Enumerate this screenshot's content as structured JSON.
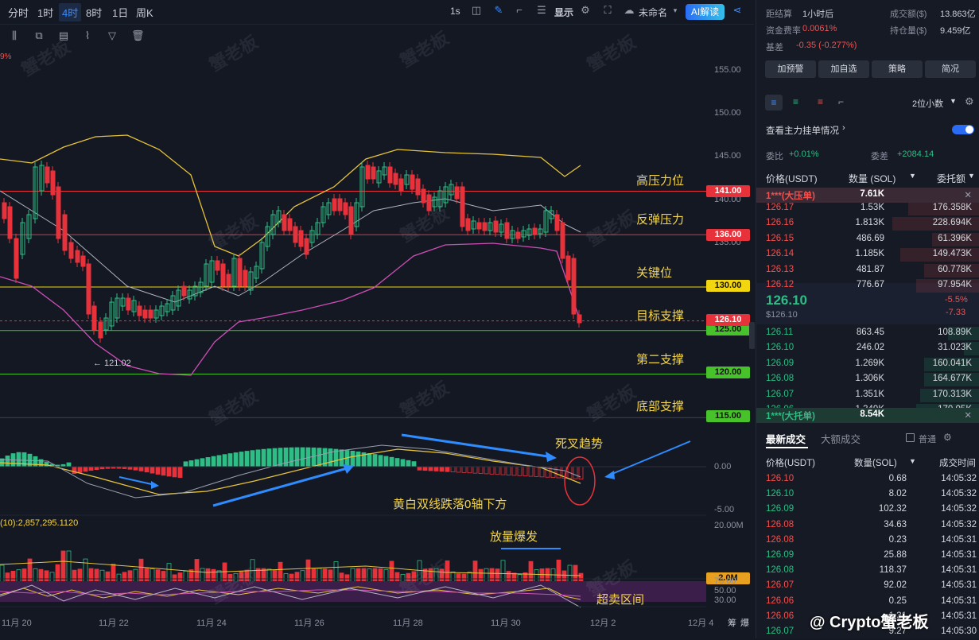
{
  "toolbar": {
    "timeframes": [
      "分时",
      "1时",
      "4时",
      "8时",
      "1日",
      "周K"
    ],
    "active_timeframe": "4时",
    "interval": "1s",
    "display_label": "显示",
    "layout_name": "未命名",
    "ai_label": "AI解读"
  },
  "chart": {
    "price_axis": [
      "155.00",
      "150.00",
      "145.00",
      "140.00",
      "135.00"
    ],
    "levels": [
      {
        "label": "高压力位",
        "price": "141.00",
        "color": "#e8323b"
      },
      {
        "label": "反弹压力",
        "price": "136.00",
        "color": "#e8323b"
      },
      {
        "label": "关键位",
        "price": "130.00",
        "color": "#f2d60f"
      },
      {
        "label": "目标支撑",
        "price": "125.00",
        "color": "#48c22a"
      },
      {
        "label": "第二支撑",
        "price": "120.00",
        "color": "#48c22a"
      },
      {
        "label": "底部支撑",
        "price": "115.00",
        "color": "#48c22a"
      }
    ],
    "current_price": "126.10",
    "low_marker": "← 121.02",
    "top_left_pct": "9%",
    "macd_axis": [
      "0.00",
      "-5.00"
    ],
    "macd_annot_1": "死叉趋势",
    "macd_annot_2": "黄白双线跌落0轴下方",
    "volume_label": "(10):2,857,295.1120",
    "volume_axis": "20.00M",
    "volume_current": "2.0M",
    "volume_annot": "放量爆发",
    "rsi_axis": [
      "70.00",
      "50.00",
      "30.00"
    ],
    "rsi_annot": "超卖区间",
    "dates": [
      "11月 20",
      "11月 22",
      "11月 24",
      "11月 26",
      "11月 28",
      "11月 30",
      "12月 2",
      "12月 4"
    ],
    "axis_corner": [
      "筹",
      "爆"
    ],
    "watermark": "蟹老板",
    "credit": "@ Crypto蟹老板"
  },
  "panel": {
    "settle_label": "距结算",
    "settle_val": "1小时后",
    "turnover_label": "成交额($)",
    "turnover_val": "13.863亿",
    "funding_label": "资金费率",
    "funding_val": "0.0061%",
    "oi_label": "持仓量($)",
    "oi_val": "9.459亿",
    "basis_label": "基差",
    "basis_val": "-0.35 (-0.277%)",
    "buttons": [
      "加预警",
      "加自选",
      "策略",
      "简况"
    ],
    "decimals": "2位小数",
    "mainforce": "查看主力挂单情况",
    "ratio_label": "委比",
    "ratio_val": "+0.01%",
    "diff_label": "委差",
    "diff_val": "+2084.14",
    "ob_headers": [
      "价格(USDT)",
      "数量 (SOL)",
      "委托额"
    ],
    "big_ask": {
      "label": "1***(大压单)",
      "qty": "7.61K"
    },
    "asks": [
      {
        "price": "126.17",
        "qty": "1.53K",
        "amt": "176.358K"
      },
      {
        "price": "126.16",
        "qty": "1.813K",
        "amt": "228.694K"
      },
      {
        "price": "126.15",
        "qty": "486.69",
        "amt": "61.396K"
      },
      {
        "price": "126.14",
        "qty": "1.185K",
        "amt": "149.473K"
      },
      {
        "price": "126.13",
        "qty": "481.87",
        "amt": "60.778K"
      },
      {
        "price": "126.12",
        "qty": "776.67",
        "amt": "97.954K"
      }
    ],
    "last_price": "126.10",
    "last_usd": "$126.10",
    "change_pct": "-5.5%",
    "change_abs": "-7.33",
    "bids": [
      {
        "price": "126.11",
        "qty": "863.45",
        "amt": "108.89K"
      },
      {
        "price": "126.10",
        "qty": "246.02",
        "amt": "31.023K"
      },
      {
        "price": "126.09",
        "qty": "1.269K",
        "amt": "160.041K"
      },
      {
        "price": "126.08",
        "qty": "1.306K",
        "amt": "164.677K"
      },
      {
        "price": "126.07",
        "qty": "1.351K",
        "amt": "170.313K"
      },
      {
        "price": "126.06",
        "qty": "1.349K",
        "amt": "170.05K"
      }
    ],
    "big_bid": {
      "label": "1***(大托单)",
      "qty": "8.54K"
    },
    "trade_tabs": [
      "最新成交",
      "大额成交"
    ],
    "normal_label": "普通",
    "trade_headers": [
      "价格(USDT)",
      "数量(SOL)",
      "成交时间"
    ],
    "trades": [
      {
        "price": "126.10",
        "qty": "0.68",
        "time": "14:05:32",
        "side": "red"
      },
      {
        "price": "126.10",
        "qty": "8.02",
        "time": "14:05:32",
        "side": "green"
      },
      {
        "price": "126.09",
        "qty": "102.32",
        "time": "14:05:32",
        "side": "green"
      },
      {
        "price": "126.08",
        "qty": "34.63",
        "time": "14:05:32",
        "side": "red"
      },
      {
        "price": "126.08",
        "qty": "0.23",
        "time": "14:05:31",
        "side": "red"
      },
      {
        "price": "126.09",
        "qty": "25.88",
        "time": "14:05:31",
        "side": "green"
      },
      {
        "price": "126.08",
        "qty": "118.37",
        "time": "14:05:31",
        "side": "green"
      },
      {
        "price": "126.07",
        "qty": "92.02",
        "time": "14:05:31",
        "side": "red"
      },
      {
        "price": "126.06",
        "qty": "0.25",
        "time": "14:05:31",
        "side": "red"
      },
      {
        "price": "126.06",
        "qty": "1.31",
        "time": "14:05:31",
        "side": "red"
      },
      {
        "price": "126.07",
        "qty": "9.27",
        "time": "14:05:30",
        "side": "green"
      }
    ]
  }
}
